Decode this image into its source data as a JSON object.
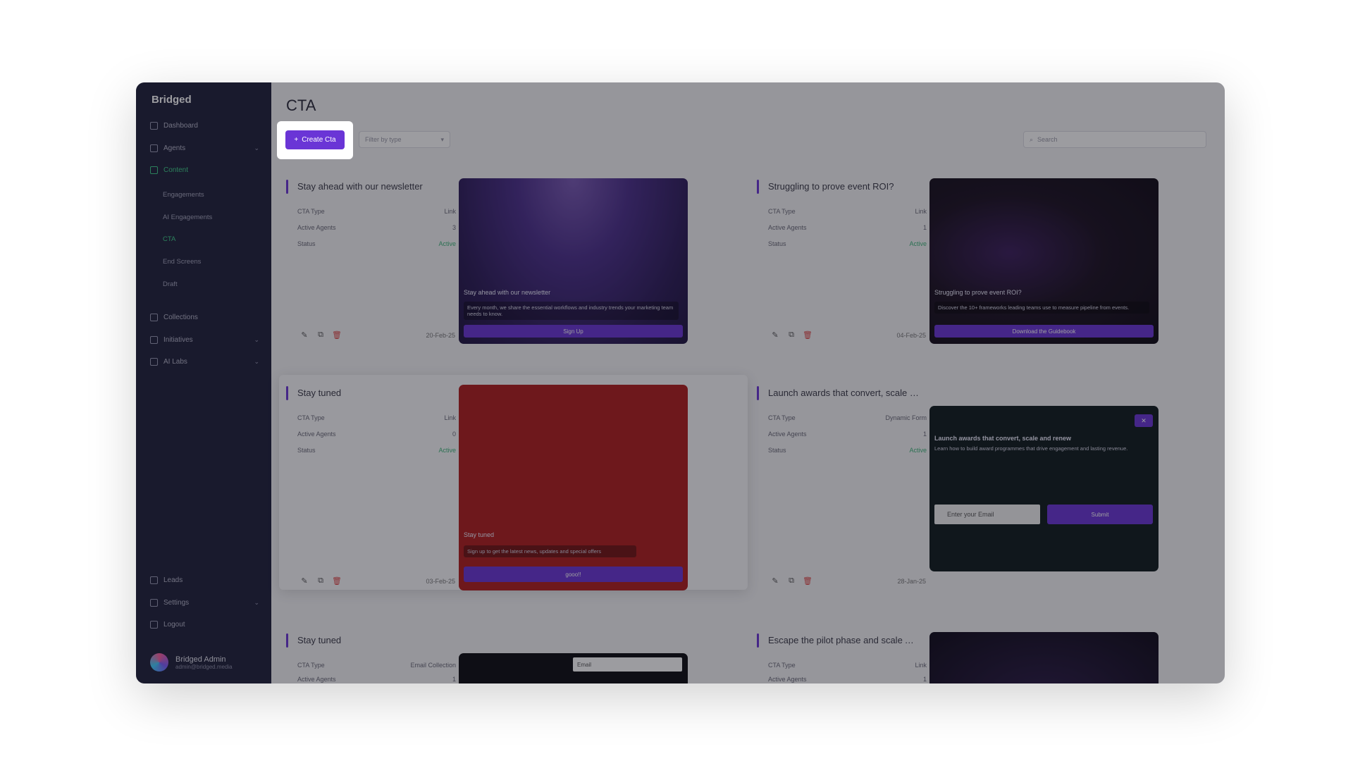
{
  "sidebar": {
    "logo": "Bridged",
    "items": [
      {
        "label": "Dashboard"
      },
      {
        "label": "Agents",
        "chevron": "⌄"
      },
      {
        "label": "Content"
      },
      {
        "label": "Collections"
      },
      {
        "label": "Initiatives",
        "chevron": "⌄"
      },
      {
        "label": "AI Labs",
        "chevron": "⌄"
      }
    ],
    "sub_items": [
      {
        "label": "Engagements"
      },
      {
        "label": "AI Engagements"
      },
      {
        "label": "CTA"
      },
      {
        "label": "End Screens"
      },
      {
        "label": "Draft"
      }
    ],
    "bottom_items": [
      {
        "label": "Leads"
      },
      {
        "label": "Settings",
        "chevron": "⌄"
      },
      {
        "label": "Logout"
      }
    ],
    "user": {
      "name": "Bridged Admin",
      "email": "admin@bridged.media"
    }
  },
  "header": {
    "title": "CTA",
    "create_label": "Create Cta",
    "filter_placeholder": "Filter by type",
    "search_placeholder": "Search"
  },
  "meta_labels": {
    "type": "CTA Type",
    "agents": "Active Agents",
    "status": "Status"
  },
  "cards": [
    {
      "title": "Stay ahead with our newsletter",
      "type": "Link",
      "agents": "3",
      "status": "Active",
      "date": "20-Feb-25",
      "preview": {
        "headline": "Stay ahead with our newsletter",
        "desc": "Every month, we share the essential workflows and industry trends your marketing team needs to know.",
        "button": "Sign Up"
      }
    },
    {
      "title": "Struggling to prove event ROI?",
      "type": "Link",
      "agents": "1",
      "status": "Active",
      "date": "04-Feb-25",
      "preview": {
        "headline": "Struggling to prove event ROI?",
        "desc": "Discover the 10+ frameworks leading teams use to measure pipeline from events.",
        "button": "Download the Guidebook"
      }
    },
    {
      "title": "Stay tuned",
      "type": "Link",
      "agents": "0",
      "status": "Active",
      "date": "03-Feb-25",
      "preview": {
        "headline": "Stay tuned",
        "desc": "Sign up to get the latest news, updates and special offers",
        "button": "gooo!!"
      }
    },
    {
      "title": "Launch awards that convert, scale and re...",
      "type": "Dynamic Form",
      "agents": "1",
      "status": "Active",
      "date": "28-Jan-25",
      "preview": {
        "headline": "Launch awards that convert, scale and renew",
        "desc": "Learn how to build award programmes that drive engagement and lasting revenue.",
        "button": "Submit",
        "input": "Enter your Email"
      }
    },
    {
      "title": "Stay tuned",
      "type": "Email Collection",
      "agents": "1",
      "preview": {
        "input": "Email"
      }
    },
    {
      "title": "Escape the pilot phase and scale AI in me...",
      "type": "Link",
      "agents": "1"
    }
  ],
  "colors": {
    "accent": "#6a35d6",
    "sidebar": "#1e1f3a",
    "active": "#3fd08a",
    "danger": "#e04646"
  }
}
